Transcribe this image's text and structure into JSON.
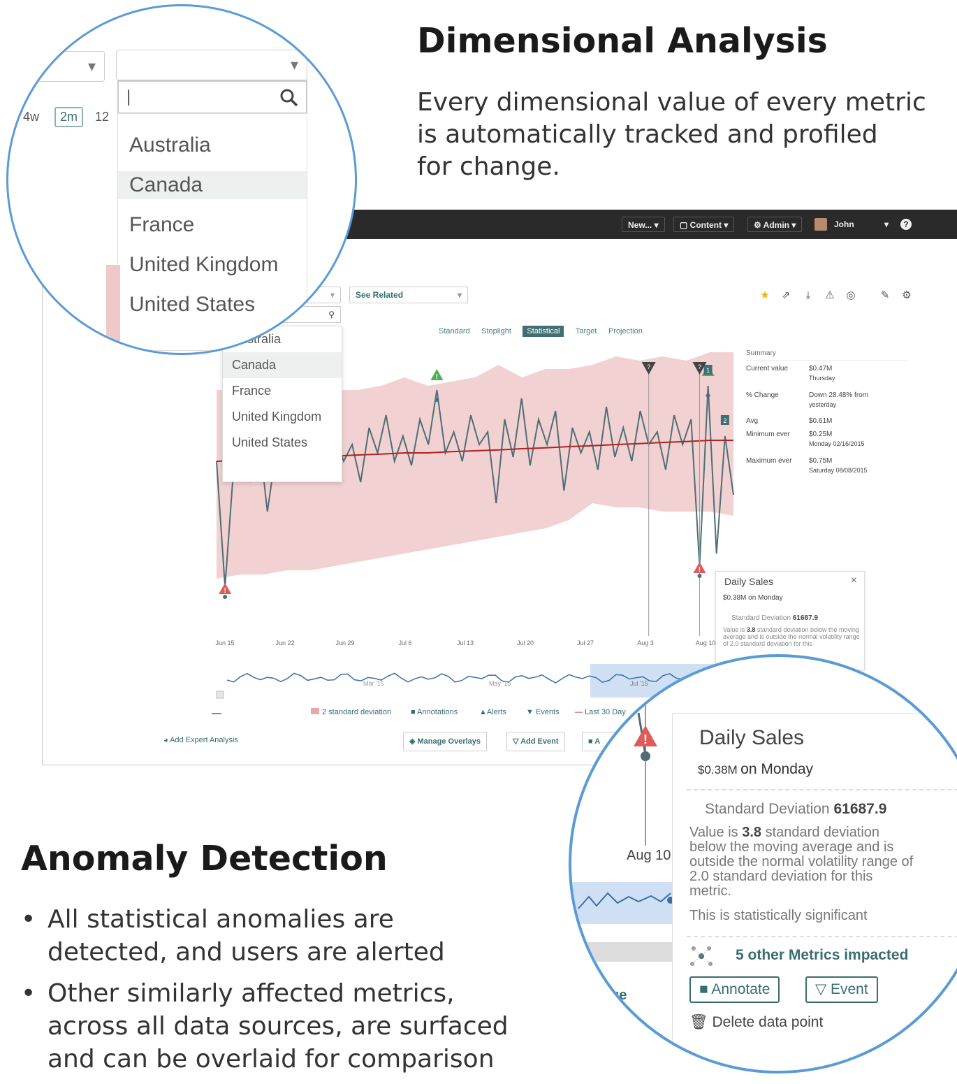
{
  "colors": {
    "accent": "#3a6d71",
    "circle_border": "#5b9bd5",
    "band": "#efc9c9",
    "avg_line": "#b22222",
    "series_line": "#4f6e74",
    "alert_red": "#e05a5a",
    "alert_green": "#4caf50"
  },
  "dimensional": {
    "title": "Dimensional Analysis",
    "lines": [
      "Every dimensional value of every metric",
      "is automatically tracked and profiled",
      "for change."
    ]
  },
  "anomaly": {
    "title": "Anomaly Detection",
    "bullets": [
      [
        "All statistical anomalies are",
        "detected, and users are alerted"
      ],
      [
        "Other similarly affected metrics,",
        "across all data sources, are surfaced",
        "and can be overlaid for comparison"
      ]
    ]
  },
  "topbar": {
    "new": "New... ▾",
    "content": "Content ▾",
    "admin": "Admin ▾",
    "user": "John",
    "help": "?"
  },
  "toolbar": {
    "see_related": "See Related"
  },
  "view_tabs": [
    "Standard",
    "Stoplight",
    "Statistical",
    "Target",
    "Projection"
  ],
  "view_active": "Statistical",
  "countries": [
    "Australia",
    "Canada",
    "France",
    "United Kingdom",
    "United States"
  ],
  "highlighted_country": "Canada",
  "zoom1": {
    "ranges": [
      "4w",
      "2m",
      "12"
    ]
  },
  "summary": {
    "heading": "Summary",
    "rows": [
      {
        "label": "Current value",
        "value": "$0.47M",
        "sub": "Thursday"
      },
      {
        "label": "% Change",
        "value": "Down 28.48% from",
        "sub": "yesterday"
      },
      {
        "label": "Avg",
        "value": "$0.61M",
        "sub": ""
      },
      {
        "label": "Minimum ever",
        "value": "$0.25M",
        "sub": "Monday 02/16/2015"
      },
      {
        "label": "Maximum ever",
        "value": "$0.75M",
        "sub": "Saturday 08/08/2015"
      }
    ]
  },
  "tooltip": {
    "title": "Daily Sales",
    "value_small": "$0.38M",
    "value_day": "on Monday",
    "sd_label": "Standard Deviation",
    "sd_value": "61687.9",
    "desc_prefix": "Value is",
    "desc_value": "3.8",
    "desc_lines": [
      "standard deviation",
      "below the moving average and is",
      "outside the normal volatility range of",
      "2.0 standard deviation for this",
      "metric."
    ],
    "significance": "This is statistically significant",
    "impacted": "5 other Metrics impacted",
    "annotate": "Annotate",
    "event": "Event",
    "delete": "Delete data point",
    "close": "×",
    "aug10": "Aug 10"
  },
  "legend": {
    "deviation": "2 standard deviation",
    "annotations": "Annotations",
    "alerts": "Alerts",
    "events": "Events",
    "last30": "Last 30 Day"
  },
  "actions": {
    "expert": "Add Expert Analysis",
    "manage": "Manage Overlays",
    "add_event": "Add Event",
    "add_partial": "A"
  },
  "nav_labels": {
    "may": "May '15",
    "jul": "Jul '15",
    "mar": "Mar '15"
  },
  "chart_data": {
    "type": "line",
    "title": "Daily Sales",
    "x_ticks": [
      "Jun 15",
      "Jun 22",
      "Jun 29",
      "Jul 6",
      "Jul 13",
      "Jul 20",
      "Jul 27",
      "Aug 3",
      "Aug 10"
    ],
    "series": [
      {
        "name": "Daily Sales",
        "values": [
          0.6,
          0.3,
          0.58,
          0.62,
          0.55,
          0.66,
          0.48,
          0.62,
          0.64,
          0.56,
          0.6,
          0.66,
          0.63,
          0.58,
          0.66,
          0.6,
          0.64,
          0.55,
          0.68,
          0.62,
          0.71,
          0.6,
          0.66,
          0.59,
          0.7,
          0.64,
          0.77,
          0.62,
          0.67,
          0.6,
          0.71,
          0.64,
          0.67,
          0.5,
          0.7,
          0.61,
          0.75,
          0.59,
          0.7,
          0.64,
          0.72,
          0.53,
          0.68,
          0.62,
          0.67,
          0.58,
          0.73,
          0.61,
          0.68,
          0.6,
          0.72,
          0.64,
          0.67,
          0.58,
          0.71,
          0.64,
          0.7,
          0.35,
          0.78,
          0.38,
          0.66,
          0.52
        ]
      }
    ],
    "moving_average": [
      0.6,
      0.602,
      0.605,
      0.607,
      0.61,
      0.612,
      0.615,
      0.617,
      0.62,
      0.62,
      0.623,
      0.625,
      0.627,
      0.63,
      0.632,
      0.635,
      0.637,
      0.64,
      0.642,
      0.645,
      0.647,
      0.65,
      0.65
    ],
    "band_upper": [
      0.77,
      0.77,
      0.77,
      0.77,
      0.77,
      0.77,
      0.77,
      0.78,
      0.8,
      0.78,
      0.79,
      0.8,
      0.83,
      0.8,
      0.82,
      0.82,
      0.83,
      0.85,
      0.84,
      0.85,
      0.84,
      0.86,
      0.86
    ],
    "band_lower": [
      0.32,
      0.33,
      0.33,
      0.34,
      0.34,
      0.35,
      0.36,
      0.37,
      0.38,
      0.39,
      0.4,
      0.41,
      0.42,
      0.43,
      0.44,
      0.46,
      0.5,
      0.49,
      0.49,
      0.48,
      0.48,
      0.48,
      0.47
    ],
    "ylim": [
      0.25,
      0.85
    ],
    "annotations": [
      {
        "type": "alert-red",
        "label": "!",
        "index": 1
      },
      {
        "type": "alert-green",
        "label": "!",
        "index": 26
      },
      {
        "type": "alert-green",
        "label": "!",
        "index": 58
      },
      {
        "type": "note",
        "label": "1",
        "index": 58
      },
      {
        "type": "note",
        "label": "2",
        "index": 60
      },
      {
        "type": "event",
        "label": "?",
        "index": 51
      },
      {
        "type": "event",
        "label": "?",
        "index": 57
      },
      {
        "type": "alert-red",
        "label": "!",
        "index": 57
      }
    ]
  }
}
